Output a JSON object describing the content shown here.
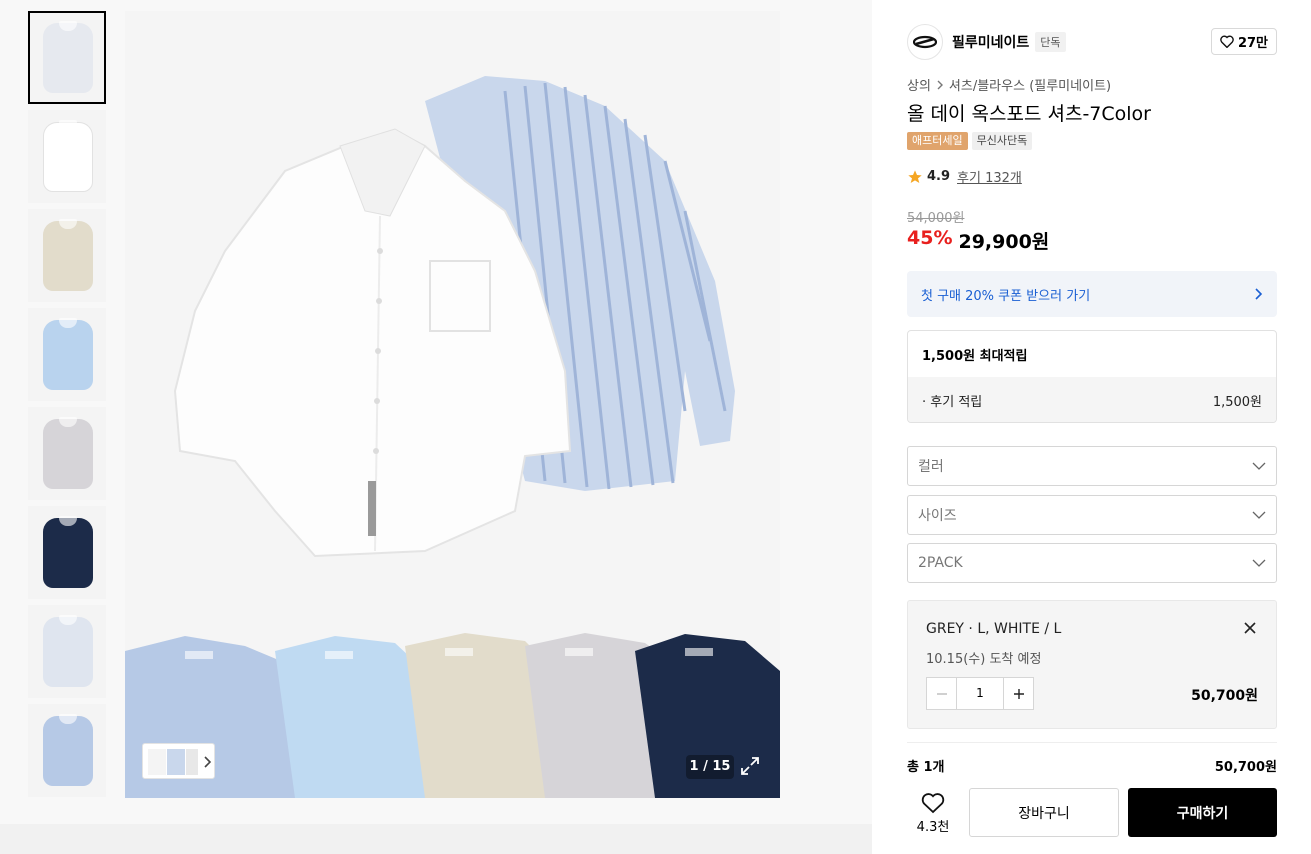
{
  "gallery": {
    "counter": "1 / 15",
    "thumbnails": [
      {
        "name": "thumb-mix",
        "color": "#e6e9ef"
      },
      {
        "name": "thumb-white",
        "color": "#ffffff"
      },
      {
        "name": "thumb-beige",
        "color": "#e2dccb"
      },
      {
        "name": "thumb-light-blue",
        "color": "#b9d3ee"
      },
      {
        "name": "thumb-grey",
        "color": "#d6d4d8"
      },
      {
        "name": "thumb-navy",
        "color": "#1c2b49"
      },
      {
        "name": "thumb-stripe",
        "color": "#dfe5ef"
      },
      {
        "name": "thumb-blue-stripe",
        "color": "#b6c9e6"
      }
    ]
  },
  "brand": {
    "name": "필루미네이트",
    "tag": "단독",
    "likes": "27만"
  },
  "breadcrumb": {
    "level1": "상의",
    "level2": "셔츠/블라우스 (필루미네이트)"
  },
  "product": {
    "title": "올 데이 옥스포드 셔츠-7Color",
    "badge_sale": "애프터세일",
    "badge_exclusive": "무신사단독",
    "rating": "4.9",
    "reviews": "후기 132개",
    "original_price": "54,000원",
    "discount": "45%",
    "price": "29,900원"
  },
  "coupon": {
    "text": "첫 구매 20% 쿠폰 받으러 가기"
  },
  "points": {
    "header": "1,500원 최대적립",
    "row_label": "· 후기 적립",
    "row_value": "1,500원"
  },
  "selects": {
    "color": "컬러",
    "size": "사이즈",
    "pack": "2PACK"
  },
  "selected_option": {
    "name": "GREY · L, WHITE / L",
    "arrival": "10.15(수) 도착 예정",
    "quantity": "1",
    "price": "50,700원"
  },
  "total": {
    "label": "총 1개",
    "value": "50,700원"
  },
  "actions": {
    "fav_count": "4.3천",
    "cart": "장바구니",
    "buy": "구매하기"
  },
  "colors": {
    "discount": "#e8201e",
    "coupon_text": "#1a5fd3",
    "coupon_bg": "#f1f4f9",
    "sale_badge": "#e0a46c",
    "buy_button": "#000000"
  }
}
